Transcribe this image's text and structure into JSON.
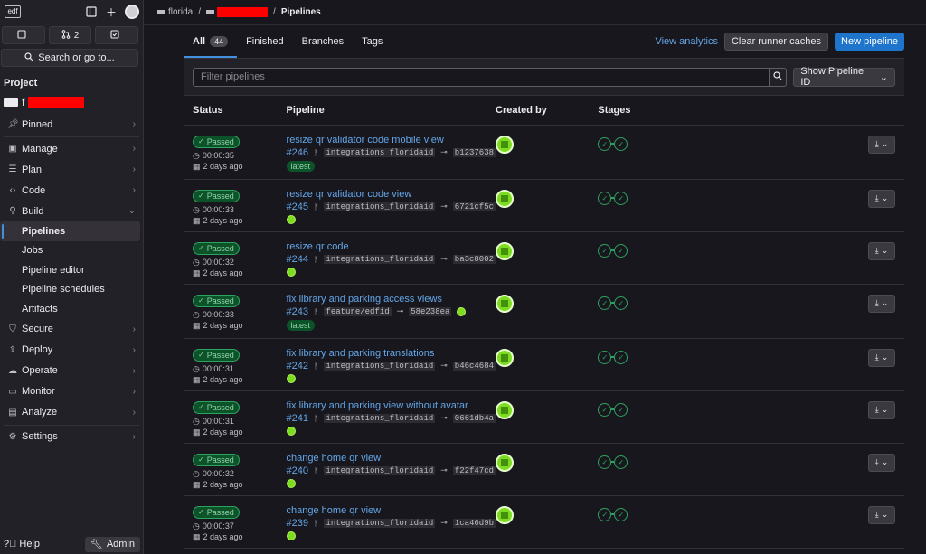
{
  "sidebar": {
    "logo": "edf",
    "counters": [
      {
        "icon": "issues-icon",
        "label": ""
      },
      {
        "icon": "merge-request-icon",
        "label": "2"
      },
      {
        "icon": "todo-icon",
        "label": ""
      }
    ],
    "search_label": "Search or go to...",
    "section_title": "Project",
    "project_name": "f",
    "nav": {
      "pinned": "Pinned",
      "manage": "Manage",
      "plan": "Plan",
      "code": "Code",
      "build": "Build",
      "build_items": [
        "Pipelines",
        "Jobs",
        "Pipeline editor",
        "Pipeline schedules",
        "Artifacts"
      ],
      "secure": "Secure",
      "deploy": "Deploy",
      "operate": "Operate",
      "monitor": "Monitor",
      "analyze": "Analyze",
      "settings": "Settings"
    },
    "help": "Help",
    "admin": "Admin"
  },
  "breadcrumb": {
    "group": "florida",
    "project": "",
    "current": "Pipelines"
  },
  "tabs": {
    "all": "All",
    "all_count": "44",
    "finished": "Finished",
    "branches": "Branches",
    "tags": "Tags"
  },
  "actions": {
    "view_analytics": "View analytics",
    "clear_cache": "Clear runner caches",
    "new_pipeline": "New pipeline"
  },
  "filter": {
    "placeholder": "Filter pipelines",
    "dropdown": "Show Pipeline ID"
  },
  "table": {
    "headers": [
      "Status",
      "Pipeline",
      "Created by",
      "Stages"
    ],
    "rows": [
      {
        "status": "Passed",
        "duration": "00:00:35",
        "ago": "2 days ago",
        "title": "resize qr validator code mobile view",
        "id": "#246",
        "branch": "integrations_floridaid",
        "sha": "b1237638",
        "latest": "latest"
      },
      {
        "status": "Passed",
        "duration": "00:00:33",
        "ago": "2 days ago",
        "title": "resize qr validator code view",
        "id": "#245",
        "branch": "integrations_floridaid",
        "sha": "6721cf5c",
        "latest": ""
      },
      {
        "status": "Passed",
        "duration": "00:00:32",
        "ago": "2 days ago",
        "title": "resize qr code",
        "id": "#244",
        "branch": "integrations_floridaid",
        "sha": "ba3c8002",
        "latest": ""
      },
      {
        "status": "Passed",
        "duration": "00:00:33",
        "ago": "2 days ago",
        "title": "fix library and parking access views",
        "id": "#243",
        "branch": "feature/edfid",
        "sha": "58e238ea",
        "latest": "latest"
      },
      {
        "status": "Passed",
        "duration": "00:00:31",
        "ago": "2 days ago",
        "title": "fix library and parking translations",
        "id": "#242",
        "branch": "integrations_floridaid",
        "sha": "b46c4684",
        "latest": ""
      },
      {
        "status": "Passed",
        "duration": "00:00:31",
        "ago": "2 days ago",
        "title": "fix library and parking view without avatar",
        "id": "#241",
        "branch": "integrations_floridaid",
        "sha": "0661db4a",
        "latest": ""
      },
      {
        "status": "Passed",
        "duration": "00:00:32",
        "ago": "2 days ago",
        "title": "change home qr view",
        "id": "#240",
        "branch": "integrations_floridaid",
        "sha": "f22f47cd",
        "latest": ""
      },
      {
        "status": "Passed",
        "duration": "00:00:37",
        "ago": "2 days ago",
        "title": "change home qr view",
        "id": "#239",
        "branch": "integrations_floridaid",
        "sha": "1ca46d9b",
        "latest": ""
      }
    ]
  },
  "colors": {
    "accent": "#1f75cb",
    "link": "#63a6e9",
    "success": "#2da160",
    "redaction": "#ff0000"
  }
}
